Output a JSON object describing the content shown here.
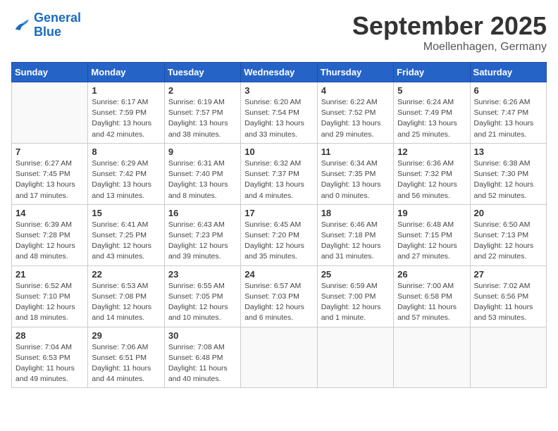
{
  "header": {
    "logo_line1": "General",
    "logo_line2": "Blue",
    "month": "September 2025",
    "location": "Moellenhagen, Germany"
  },
  "days_of_week": [
    "Sunday",
    "Monday",
    "Tuesday",
    "Wednesday",
    "Thursday",
    "Friday",
    "Saturday"
  ],
  "weeks": [
    [
      {
        "day": "",
        "info": ""
      },
      {
        "day": "1",
        "info": "Sunrise: 6:17 AM\nSunset: 7:59 PM\nDaylight: 13 hours\nand 42 minutes."
      },
      {
        "day": "2",
        "info": "Sunrise: 6:19 AM\nSunset: 7:57 PM\nDaylight: 13 hours\nand 38 minutes."
      },
      {
        "day": "3",
        "info": "Sunrise: 6:20 AM\nSunset: 7:54 PM\nDaylight: 13 hours\nand 33 minutes."
      },
      {
        "day": "4",
        "info": "Sunrise: 6:22 AM\nSunset: 7:52 PM\nDaylight: 13 hours\nand 29 minutes."
      },
      {
        "day": "5",
        "info": "Sunrise: 6:24 AM\nSunset: 7:49 PM\nDaylight: 13 hours\nand 25 minutes."
      },
      {
        "day": "6",
        "info": "Sunrise: 6:26 AM\nSunset: 7:47 PM\nDaylight: 13 hours\nand 21 minutes."
      }
    ],
    [
      {
        "day": "7",
        "info": "Sunrise: 6:27 AM\nSunset: 7:45 PM\nDaylight: 13 hours\nand 17 minutes."
      },
      {
        "day": "8",
        "info": "Sunrise: 6:29 AM\nSunset: 7:42 PM\nDaylight: 13 hours\nand 13 minutes."
      },
      {
        "day": "9",
        "info": "Sunrise: 6:31 AM\nSunset: 7:40 PM\nDaylight: 13 hours\nand 8 minutes."
      },
      {
        "day": "10",
        "info": "Sunrise: 6:32 AM\nSunset: 7:37 PM\nDaylight: 13 hours\nand 4 minutes."
      },
      {
        "day": "11",
        "info": "Sunrise: 6:34 AM\nSunset: 7:35 PM\nDaylight: 13 hours\nand 0 minutes."
      },
      {
        "day": "12",
        "info": "Sunrise: 6:36 AM\nSunset: 7:32 PM\nDaylight: 12 hours\nand 56 minutes."
      },
      {
        "day": "13",
        "info": "Sunrise: 6:38 AM\nSunset: 7:30 PM\nDaylight: 12 hours\nand 52 minutes."
      }
    ],
    [
      {
        "day": "14",
        "info": "Sunrise: 6:39 AM\nSunset: 7:28 PM\nDaylight: 12 hours\nand 48 minutes."
      },
      {
        "day": "15",
        "info": "Sunrise: 6:41 AM\nSunset: 7:25 PM\nDaylight: 12 hours\nand 43 minutes."
      },
      {
        "day": "16",
        "info": "Sunrise: 6:43 AM\nSunset: 7:23 PM\nDaylight: 12 hours\nand 39 minutes."
      },
      {
        "day": "17",
        "info": "Sunrise: 6:45 AM\nSunset: 7:20 PM\nDaylight: 12 hours\nand 35 minutes."
      },
      {
        "day": "18",
        "info": "Sunrise: 6:46 AM\nSunset: 7:18 PM\nDaylight: 12 hours\nand 31 minutes."
      },
      {
        "day": "19",
        "info": "Sunrise: 6:48 AM\nSunset: 7:15 PM\nDaylight: 12 hours\nand 27 minutes."
      },
      {
        "day": "20",
        "info": "Sunrise: 6:50 AM\nSunset: 7:13 PM\nDaylight: 12 hours\nand 22 minutes."
      }
    ],
    [
      {
        "day": "21",
        "info": "Sunrise: 6:52 AM\nSunset: 7:10 PM\nDaylight: 12 hours\nand 18 minutes."
      },
      {
        "day": "22",
        "info": "Sunrise: 6:53 AM\nSunset: 7:08 PM\nDaylight: 12 hours\nand 14 minutes."
      },
      {
        "day": "23",
        "info": "Sunrise: 6:55 AM\nSunset: 7:05 PM\nDaylight: 12 hours\nand 10 minutes."
      },
      {
        "day": "24",
        "info": "Sunrise: 6:57 AM\nSunset: 7:03 PM\nDaylight: 12 hours\nand 6 minutes."
      },
      {
        "day": "25",
        "info": "Sunrise: 6:59 AM\nSunset: 7:00 PM\nDaylight: 12 hours\nand 1 minute."
      },
      {
        "day": "26",
        "info": "Sunrise: 7:00 AM\nSunset: 6:58 PM\nDaylight: 11 hours\nand 57 minutes."
      },
      {
        "day": "27",
        "info": "Sunrise: 7:02 AM\nSunset: 6:56 PM\nDaylight: 11 hours\nand 53 minutes."
      }
    ],
    [
      {
        "day": "28",
        "info": "Sunrise: 7:04 AM\nSunset: 6:53 PM\nDaylight: 11 hours\nand 49 minutes."
      },
      {
        "day": "29",
        "info": "Sunrise: 7:06 AM\nSunset: 6:51 PM\nDaylight: 11 hours\nand 44 minutes."
      },
      {
        "day": "30",
        "info": "Sunrise: 7:08 AM\nSunset: 6:48 PM\nDaylight: 11 hours\nand 40 minutes."
      },
      {
        "day": "",
        "info": ""
      },
      {
        "day": "",
        "info": ""
      },
      {
        "day": "",
        "info": ""
      },
      {
        "day": "",
        "info": ""
      }
    ]
  ]
}
